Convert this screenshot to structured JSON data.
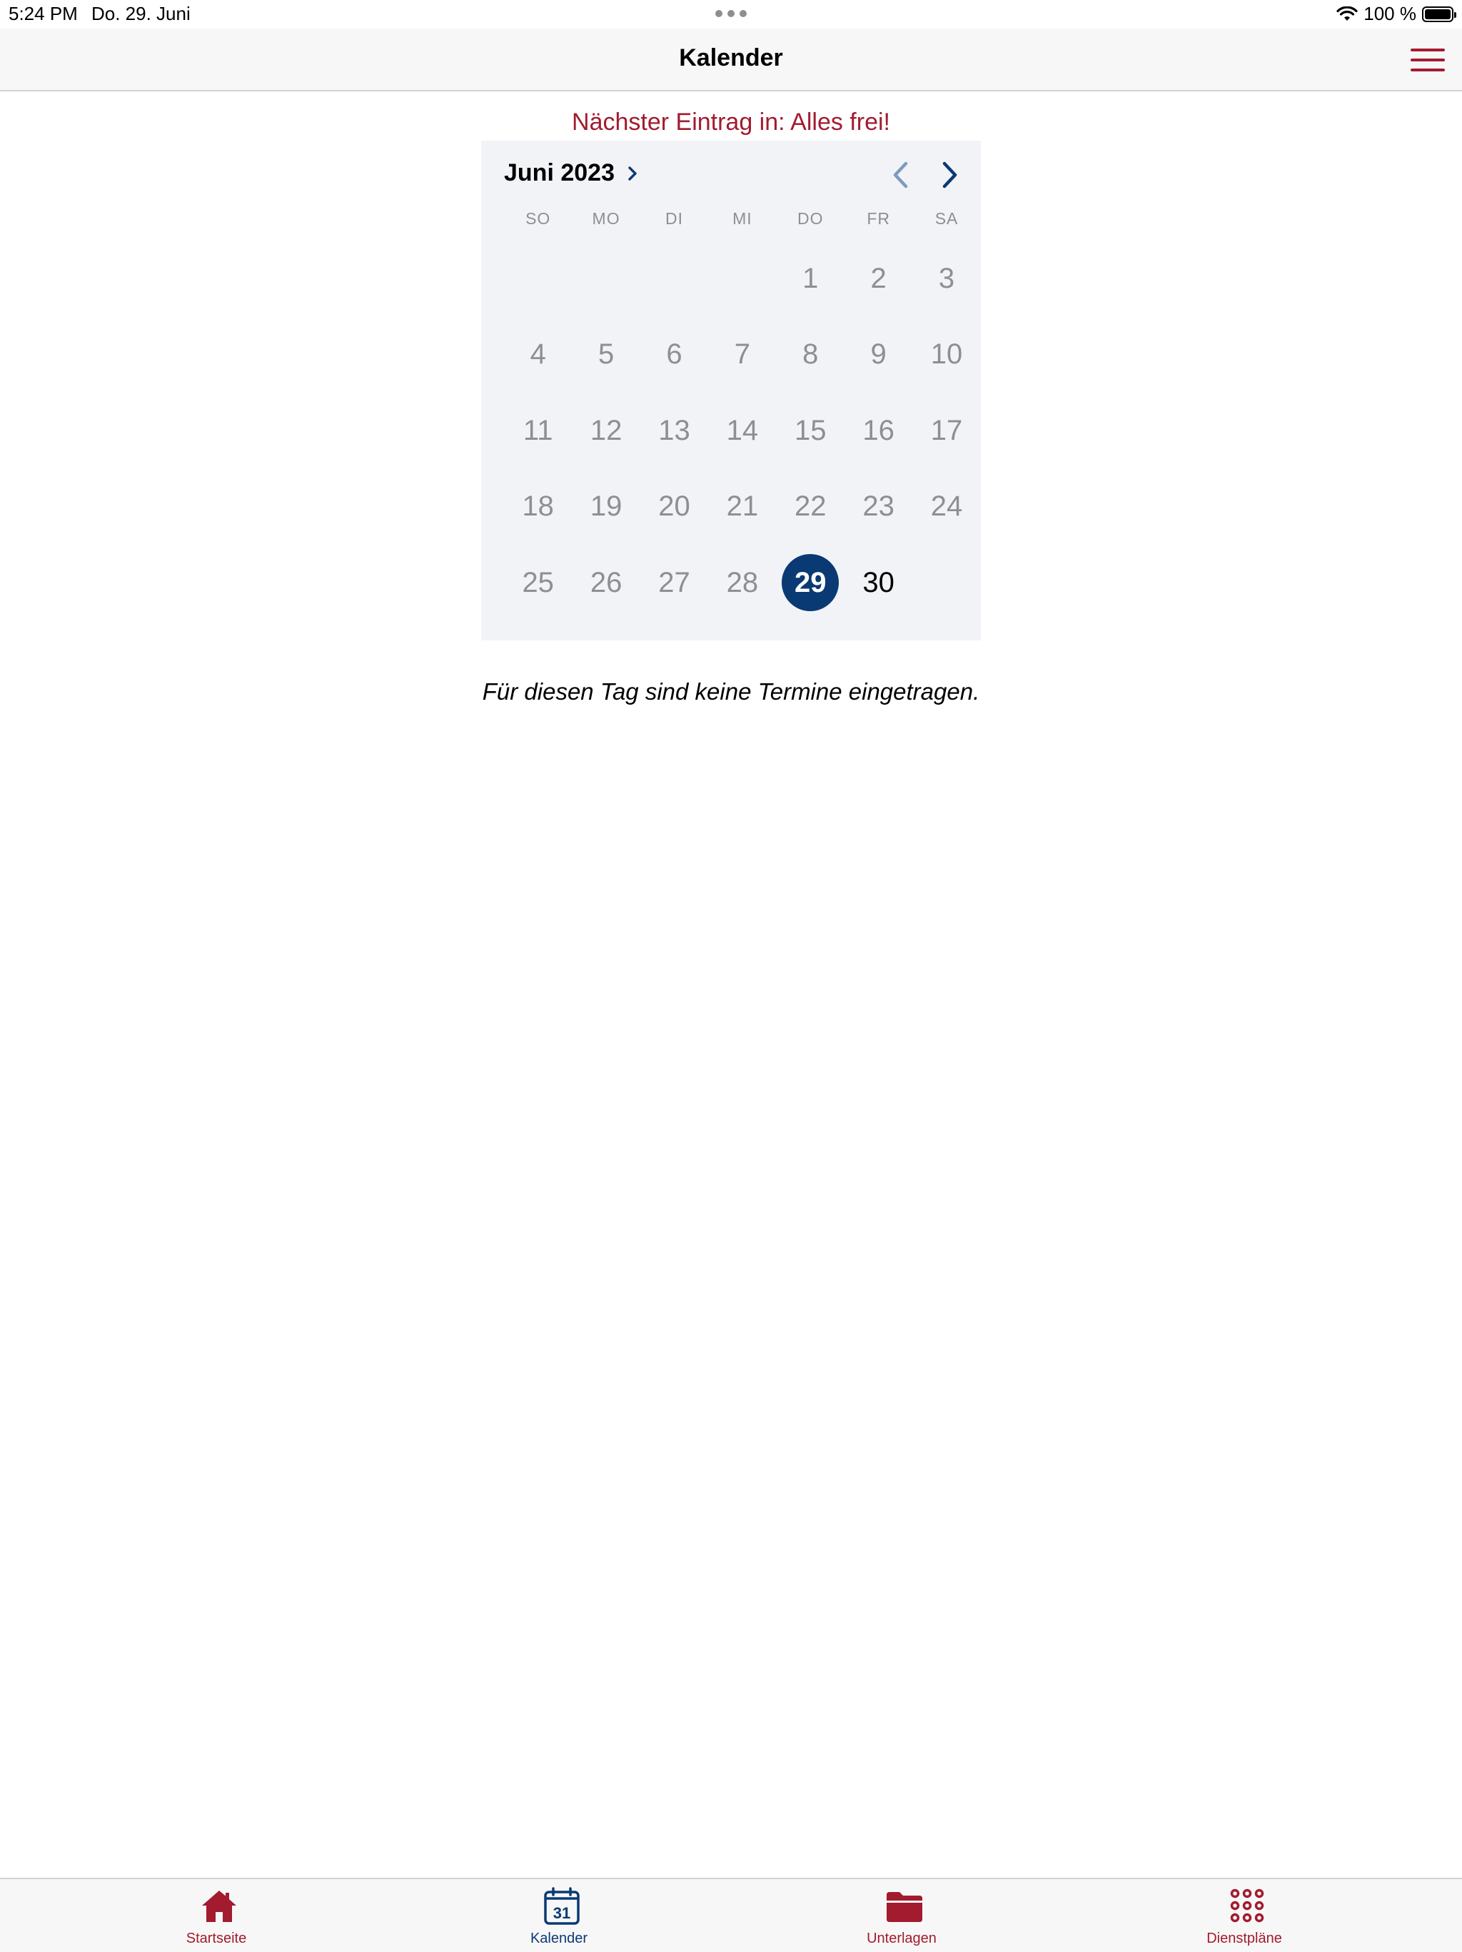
{
  "status_bar": {
    "time": "5:24 PM",
    "date": "Do. 29. Juni",
    "battery": "100 %"
  },
  "nav": {
    "title": "Kalender"
  },
  "next_entry": "Nächster Eintrag in: Alles frei!",
  "calendar": {
    "month_label": "Juni 2023",
    "weekdays": [
      "SO",
      "MO",
      "DI",
      "MI",
      "DO",
      "FR",
      "SA"
    ],
    "days": [
      "",
      "",
      "",
      "",
      "1",
      "2",
      "3",
      "4",
      "5",
      "6",
      "7",
      "8",
      "9",
      "10",
      "11",
      "12",
      "13",
      "14",
      "15",
      "16",
      "17",
      "18",
      "19",
      "20",
      "21",
      "22",
      "23",
      "24",
      "25",
      "26",
      "27",
      "28",
      "29",
      "30",
      ""
    ],
    "selected_day": "29",
    "accent_color": "#0a3a74"
  },
  "no_events_text": "Für diesen Tag sind keine Termine eingetragen.",
  "tabs": [
    {
      "label": "Startseite",
      "icon": "home-icon",
      "color": "#a21b2f"
    },
    {
      "label": "Kalender",
      "icon": "calendar-icon",
      "color": "#0a3a74",
      "calendar_icon_number": "31"
    },
    {
      "label": "Unterlagen",
      "icon": "folder-icon",
      "color": "#a21b2f"
    },
    {
      "label": "Dienstpläne",
      "icon": "grid-dots-icon",
      "color": "#a21b2f"
    }
  ]
}
